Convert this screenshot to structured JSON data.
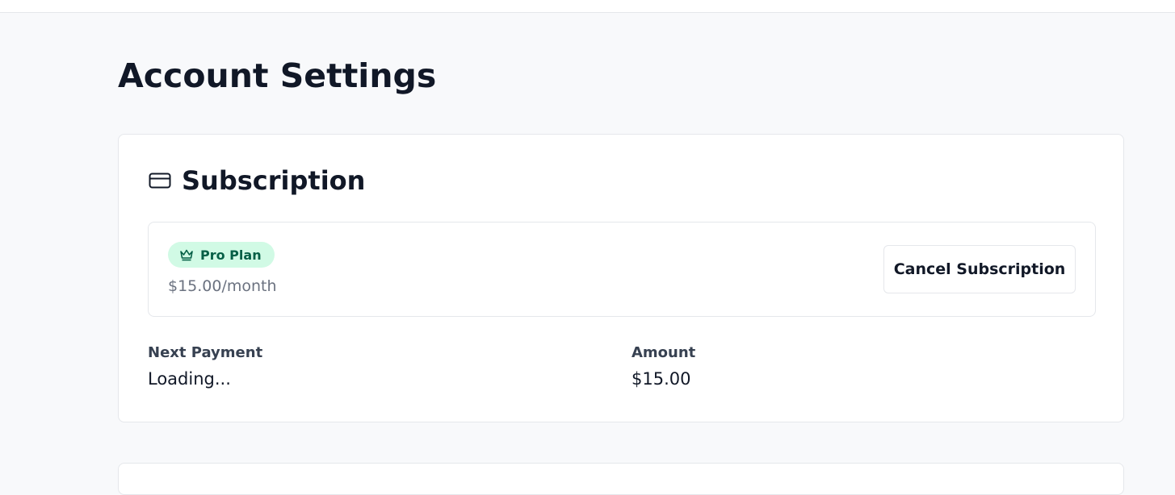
{
  "page": {
    "title": "Account Settings"
  },
  "subscription": {
    "title": "Subscription",
    "icon": "credit-card-icon",
    "plan": {
      "badge_label": "Pro Plan",
      "badge_icon": "crown-icon",
      "badge_bg": "#d1fae5",
      "badge_fg": "#065f46",
      "price": "$15.00/month"
    },
    "cancel_label": "Cancel Subscription",
    "next_payment": {
      "label": "Next Payment",
      "value": "Loading..."
    },
    "amount": {
      "label": "Amount",
      "value": "$15.00"
    }
  }
}
